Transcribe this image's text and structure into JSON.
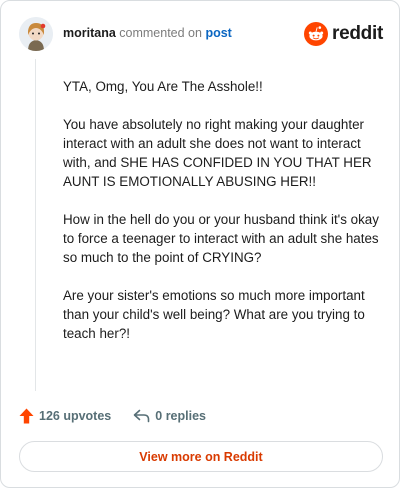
{
  "header": {
    "username": "moritana",
    "action_text": "commented on",
    "post_link": "post",
    "brand_word": "reddit"
  },
  "comment": {
    "paragraphs": [
      "YTA, Omg, You Are The Asshole!!",
      "You have absolutely no right making your daughter interact with an adult she does not want to interact with, and SHE HAS CONFIDED IN YOU THAT HER AUNT IS EMOTIONALLY ABUSING HER!!",
      "How in the hell do you or your husband think it's okay to force a teenager to interact with an adult she hates so much to the point of CRYING?",
      "Are your sister's emotions so much more important than your child's well being? What are you trying to teach her?!"
    ]
  },
  "footer": {
    "upvotes_label": "126 upvotes",
    "replies_label": "0 replies"
  },
  "actions": {
    "view_more_label": "View more on Reddit"
  },
  "colors": {
    "reddit_orange": "#ff4500",
    "link_blue": "#0a66c2",
    "cta_text": "#d93a00"
  },
  "icons": {
    "avatar": "snoo-avatar",
    "logo": "reddit-logo-icon",
    "upvote": "upvote-arrow-icon",
    "reply": "reply-arrow-icon"
  }
}
